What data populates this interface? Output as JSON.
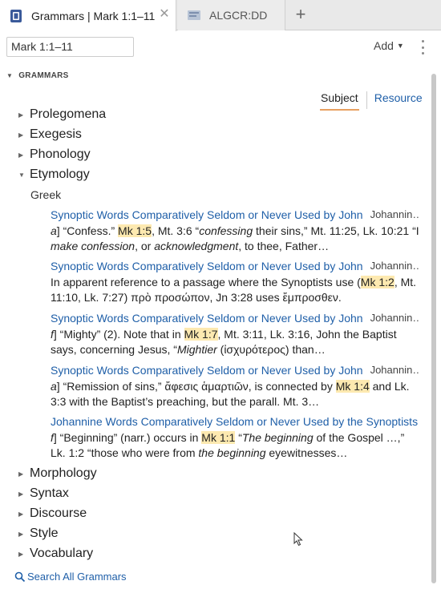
{
  "tabs": [
    {
      "label": "Grammars | Mark 1:1–11",
      "active": true
    },
    {
      "label": "ALGCR:DD",
      "active": false
    }
  ],
  "toolbar": {
    "reference": "Mark 1:1–11",
    "add_label": "Add"
  },
  "section": {
    "title": "GRAMMARS"
  },
  "switch": {
    "subject": "Subject",
    "resource": "Resource"
  },
  "tree": {
    "prolegomena": "Prolegomena",
    "exegesis": "Exegesis",
    "phonology": "Phonology",
    "etymology": "Etymology",
    "morphology": "Morphology",
    "syntax": "Syntax",
    "discourse": "Discourse",
    "style": "Style",
    "vocabulary": "Vocabulary"
  },
  "subhead": "Greek",
  "entries": [
    {
      "title": "Synoptic Words Comparatively Seldom or Never Used by John",
      "source": "Johannin…",
      "t1": "a",
      "t2": "] “Confess.” ",
      "ref": "Mk 1:5",
      "t3": ", Mt. 3:6 “",
      "t4": "confessing",
      "t5": " their sins,” Mt. 11:25, Lk. 10:21 “I ",
      "t6": "make confession",
      "t7": ", or ",
      "t8": "acknowledgment",
      "t9": ", to thee, Father…"
    },
    {
      "title": "Synoptic Words Comparatively Seldom or Never Used by John",
      "source": "Johannin…",
      "t1": "In apparent reference to a passage where the Synoptists use (",
      "ref": "Mk 1:2",
      "t2": ", Mt. 11:10, Lk. 7:27) πρὸ προσώπον, Jn 3:28 uses ἔμπροσθεν."
    },
    {
      "title": "Synoptic Words Comparatively Seldom or Never Used by John",
      "source": "Johannin…",
      "t1": "f",
      "t2": "] “Mighty” (2). Note that in ",
      "ref": "Mk 1:7",
      "t3": ", Mt. 3:11, Lk. 3:16, John the Baptist says, concerning Jesus, “",
      "t4": "Mightier",
      "t5": " (ἰσχυρότερος) than…"
    },
    {
      "title": "Synoptic Words Comparatively Seldom or Never Used by John",
      "source": "Johannin…",
      "t1": "a",
      "t2": "] “Remission of sins,” ἄφεσις ἁμαρτιῶν, is connected by ",
      "ref": "Mk 1:4",
      "t3": " and Lk. 3:3 with the Baptist’s preaching, but the parall. Mt. 3…"
    },
    {
      "title": "Johannine Words Comparatively Seldom or Never Used by the Synoptists",
      "source": ".",
      "t1": "f",
      "t2": "] “Beginning” (narr.) occurs in ",
      "ref": "Mk 1:1",
      "t3": " “",
      "t4": "The beginning",
      "t5": " of the Gospel …,” Lk. 1:2 “those who were from ",
      "t6": "the beginning",
      "t7": " eyewitnesses…"
    }
  ],
  "search_all": "Search All Grammars",
  "colors": {
    "link": "#1f5fa8",
    "highlight": "#fde9b0",
    "underline": "#e8a060"
  }
}
